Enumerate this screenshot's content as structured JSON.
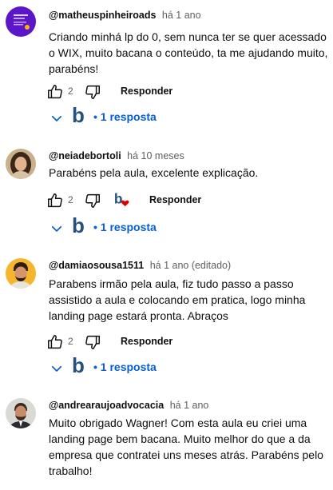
{
  "comments": [
    {
      "author": "@matheuspinheiroads",
      "time": "há 1 ano",
      "text": "Criando minhá lp do 0, sem nunca ter se quer acessado o WIX, muito bacana o conteúdo, ta me ajudando muito, parabéns!",
      "likes": "2",
      "reply_label": "Responder",
      "replies_label": "• 1 resposta"
    },
    {
      "author": "@neiadebortoli",
      "time": "há 10 meses",
      "text": "Parabéns pela aula, excelente explicação.",
      "likes": "2",
      "reply_label": "Responder",
      "replies_label": "• 1 resposta"
    },
    {
      "author": "@damiaosousa1511",
      "time": "há 1 ano (editado)",
      "text": "Parabens irmão pela aula, fiz tudo passo a passo assistido a aula e colocando em pratica, logo minha landing page estará pronta. Abraços",
      "likes": "2",
      "reply_label": "Responder",
      "replies_label": "• 1 resposta"
    },
    {
      "author": "@andrearaujoadvocacia",
      "time": "há 1 ano",
      "text": "Muito obrigado Wagner! Com esta aula eu criei uma landing page bem bacana. Muito melhor do que a da empresa que contratei uns meses atrás. Parabéns pelo trabalho!"
    }
  ],
  "creator_badge": "b",
  "colors": {
    "link_blue": "#065fd4",
    "creator_blue": "#27527e",
    "heart_red": "#e00000",
    "meta_gray": "#606060"
  },
  "icons": [
    "like-icon",
    "dislike-icon",
    "chevron-down-icon",
    "creator-heart-icon"
  ]
}
